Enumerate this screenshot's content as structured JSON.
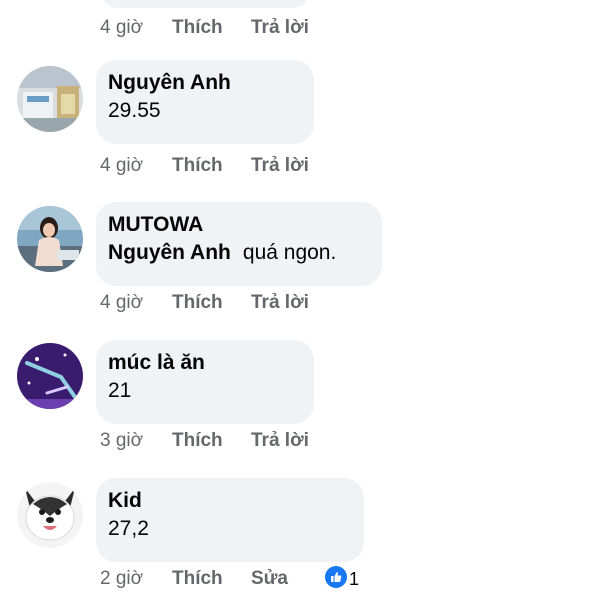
{
  "actions": {
    "like": "Thích",
    "reply": "Trả lời",
    "edit": "Sửa"
  },
  "top_row": {
    "time": "4 giờ"
  },
  "comments": [
    {
      "author": "Nguyên Anh",
      "text": "29.55",
      "time": "4 giờ"
    },
    {
      "author": "MUTOWA",
      "mention": "Nguyên Anh",
      "text": "quá ngon.",
      "time": "4 giờ"
    },
    {
      "author": "múc là ăn",
      "text": "21",
      "time": "3 giờ"
    },
    {
      "author": "Kid",
      "text": "27,2",
      "time": "2 giờ",
      "reaction_count": "1"
    }
  ],
  "colors": {
    "bubble": "#f0f2f5",
    "meta_text": "#65676b",
    "like_blue": "#1877f2"
  },
  "icons": {
    "reaction": "thumbs-up-icon"
  }
}
